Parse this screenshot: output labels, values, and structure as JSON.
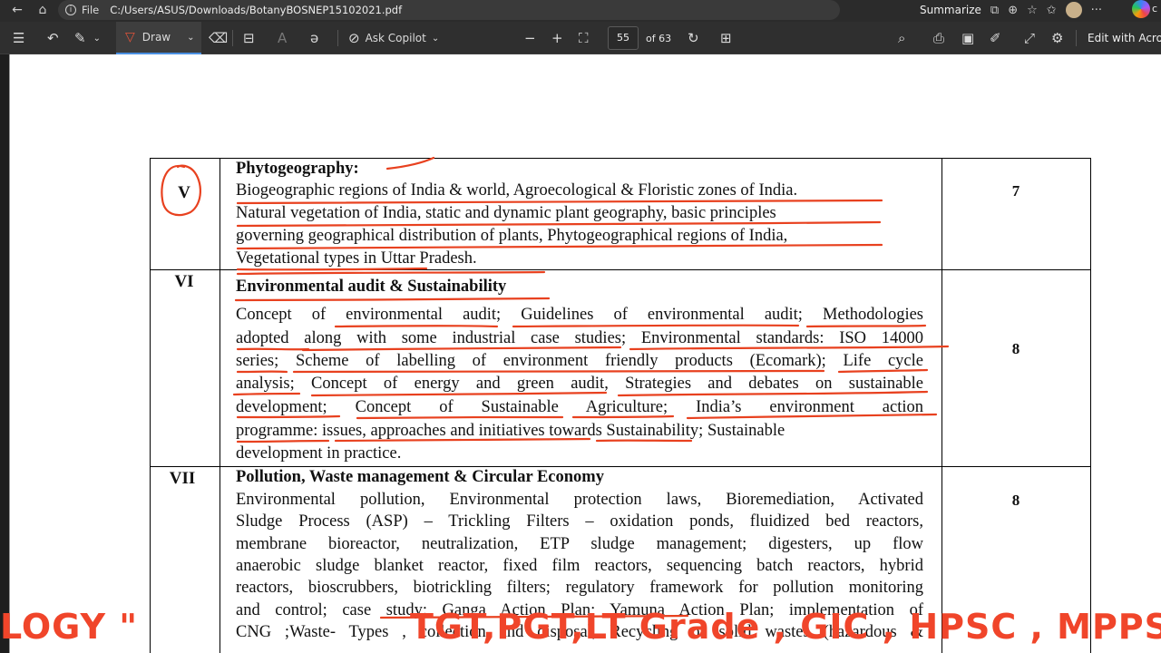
{
  "browser": {
    "file_label": "File",
    "url": "C:/Users/ASUS/Downloads/BotanyBOSNEP15102021.pdf",
    "summarize_label": "Summarize",
    "more_label": "···",
    "right_cut_text": "c"
  },
  "toolbar": {
    "draw_label": "Draw",
    "ask_copilot_label": "Ask Copilot",
    "page_number": "55",
    "of_pages": "of 63",
    "edit_label": "Edit with Acrob"
  },
  "syllabus": {
    "rows": [
      {
        "unit": "V",
        "hours": "7",
        "heading": "Phytogeography:",
        "lines": [
          "Biogeographic regions of India & world, Agroecological & Floristic zones of India.",
          "Natural vegetation of India, static and dynamic plant geography, basic principles",
          "governing geographical distribution of plants, Phytogeographical regions of India,",
          "Vegetational types in Uttar Pradesh."
        ]
      },
      {
        "unit": "VI",
        "hours": "8",
        "heading": "Environmental audit & Sustainability",
        "lines": [
          "Concept of environmental audit; Guidelines of environmental audit; Methodologies",
          "adopted along with some industrial case studies; Environmental standards: ISO 14000",
          "series; Scheme of labelling of environment friendly products (Ecomark); Life cycle",
          "analysis; Concept of energy and green audit, Strategies and debates on sustainable",
          "development; Concept of Sustainable Agriculture; India’s environment action",
          "programme: issues, approaches and initiatives towards Sustainability; Sustainable",
          "development in practice."
        ]
      },
      {
        "unit": "VII",
        "hours": "8",
        "heading": "Pollution, Waste management & Circular Economy",
        "lines": [
          "Environmental pollution, Environmental protection laws, Bioremediation, Activated",
          "Sludge Process (ASP) – Trickling Filters – oxidation ponds, fluidized bed reactors,",
          "membrane bioreactor, neutralization, ETP sludge management; digesters, up flow",
          "anaerobic sludge blanket reactor, fixed film reactors, sequencing batch reactors, hybrid",
          "reactors, bioscrubbers, biotrickling filters; regulatory framework for pollution monitoring",
          "and control; case study: Ganga Action Plan; Yamuna Action Plan; implementation of",
          "CNG ;Waste- Types , collection and disposal, Recycling of solid wastes (hazardous &"
        ]
      }
    ]
  },
  "overlay": {
    "left_caption": "LOGY \"",
    "right_caption": "TGT,PGT,LT Grade , GIC , HPSC , MPPSC,"
  },
  "colors": {
    "ink": "#e8411f",
    "overlay": "#f0452a",
    "toolbar_bg": "#2f2f2f"
  }
}
